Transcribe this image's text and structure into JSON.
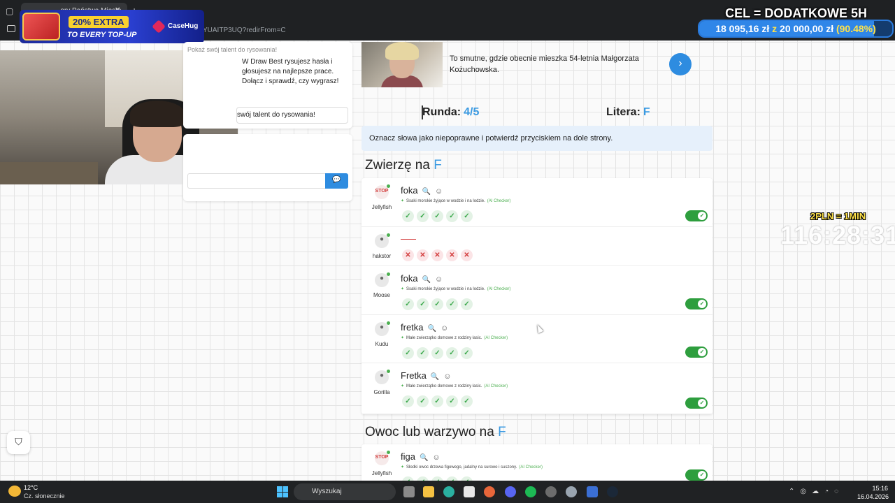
{
  "browser": {
    "tab_title": "...ory Państwa Miasta",
    "url": "YUAITP3UQ?redirFrom=C"
  },
  "promo": {
    "extra": "20% EXTRA",
    "topup": "TO EVERY TOP-UP",
    "logo": "CaseHug"
  },
  "goal": {
    "title": "CEL = DODATKOWE 5H",
    "current": "18 095,16 zł",
    "z": "z",
    "target": "20 000,00 zł",
    "percent_text": "(90.48%)",
    "progress": 0.9048
  },
  "sidebar": {
    "draw_label": "Pokaż swój talent do rysowania!",
    "draw_text": "W Draw Best rysujesz hasła i głosujesz na najlepsze prace. Dołącz i sprawdź, czy wygrasz!",
    "draw_button": "swój talent do rysowania!"
  },
  "news": {
    "text": "To smutne, gdzie obecnie mieszka 54-letnia Małgorzata Kożuchowska."
  },
  "round": {
    "label": "Runda:",
    "value": "4/5",
    "letter_label": "Litera:",
    "letter": "F"
  },
  "notice": "Oznacz słowa jako niepoprawne i potwierdź przyciskiem na dole strony.",
  "categories": [
    {
      "title": "Zwierzę na",
      "letter": "F",
      "answers": [
        {
          "player": "Jellyfish",
          "word": "foka",
          "desc": "Ssaki morskie żyjące w wodzie i na lodzie.",
          "ai": "(AI Checker)"
        },
        {
          "player": "hakstor",
          "word": "",
          "desc": "",
          "ai": ""
        },
        {
          "player": "Moose",
          "word": "foka",
          "desc": "Ssaki morskie żyjące w wodzie i na lodzie.",
          "ai": "(AI Checker)"
        },
        {
          "player": "Kudu",
          "word": "fretka",
          "desc": "Małe zwierzątko domowe z rodziny łasic.",
          "ai": "(AI Checker)"
        },
        {
          "player": "Gorilla",
          "word": "Fretka",
          "desc": "Małe zwierzątko domowe z rodziny łasic.",
          "ai": "(AI Checker)"
        }
      ]
    },
    {
      "title": "Owoc lub warzywo na",
      "letter": "F",
      "answers": [
        {
          "player": "Jellyfish",
          "word": "figa",
          "desc": "Słodki owoc drzewa figowego, jadalny na surowo i suszony.",
          "ai": "(AI Checker)"
        }
      ]
    }
  ],
  "stream": {
    "rate": "2PLN = 1MIN",
    "timer": "116:28:31"
  },
  "taskbar": {
    "temp": "12°C",
    "weather": "Cz. słonecznie",
    "search": "Wyszukaj",
    "time": "15:16",
    "date": "16.04.2026"
  },
  "icons": {
    "check": "✓",
    "cross": "✕",
    "search": "🔍",
    "emoji": "☺",
    "chat": "💬",
    "next": "›",
    "shield": "⛉"
  },
  "colors": {
    "accent": "#3a9ae2",
    "ok": "#3aa84a",
    "bad": "#d23b3b",
    "toggle": "#2e9e3e"
  }
}
